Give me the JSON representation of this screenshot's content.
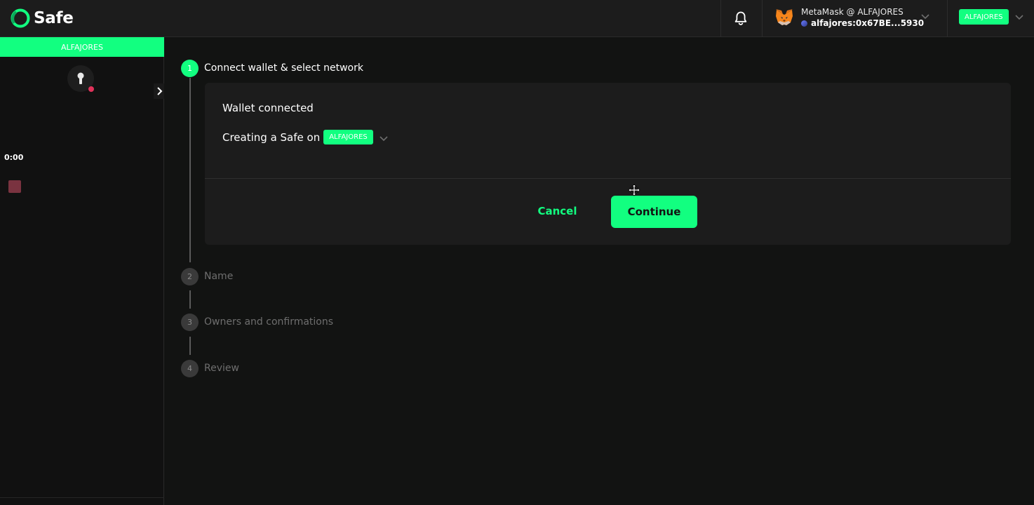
{
  "header": {
    "brand": "Safe",
    "wallet": {
      "name": "MetaMask @ ALFAJORES",
      "address": "alfajores:0x67BE...5930"
    },
    "network_badge": "ALFAJORES"
  },
  "sidebar": {
    "network_band": "ALFAJORES",
    "timer": "0:00"
  },
  "stepper": {
    "steps": [
      {
        "number": "1",
        "label": "Connect wallet & select network"
      },
      {
        "number": "2",
        "label": "Name"
      },
      {
        "number": "3",
        "label": "Owners and confirmations"
      },
      {
        "number": "4",
        "label": "Review"
      }
    ]
  },
  "card": {
    "title": "Wallet connected",
    "creating_text": "Creating a Safe on",
    "chain_badge": "ALFAJORES",
    "cancel_label": "Cancel",
    "continue_label": "Continue"
  },
  "colors": {
    "accent": "#12ff80",
    "background": "#121312",
    "card": "#1c1c1c"
  },
  "icons": [
    "safe-logo-icon",
    "bell-icon",
    "metamask-fox-icon",
    "chevron-down-icon",
    "keyhole-icon",
    "chevron-right-icon",
    "move-cursor-icon"
  ]
}
